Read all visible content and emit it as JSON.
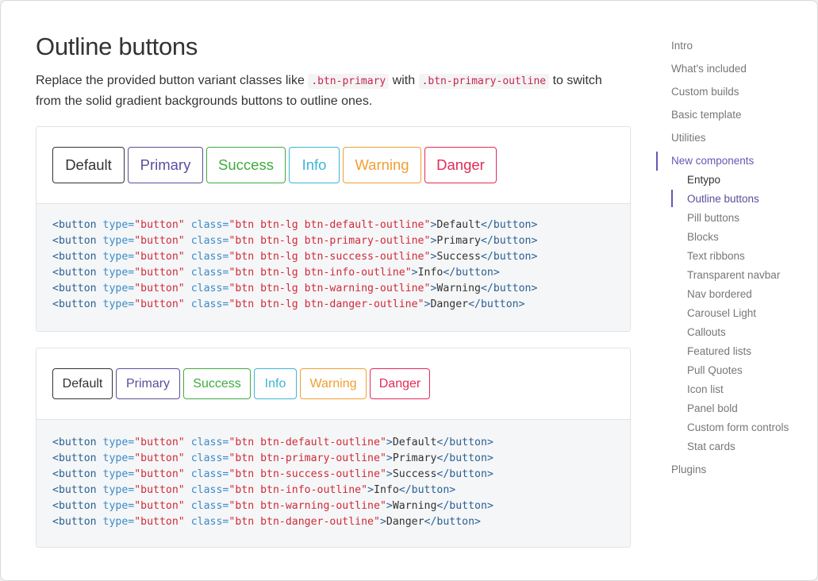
{
  "header": {
    "title": "Outline buttons",
    "lead_before": "Replace the provided button variant classes like ",
    "lead_code1": ".btn-primary",
    "lead_mid": " with ",
    "lead_code2": ".btn-primary-outline",
    "lead_after": " to switch from the solid gradient backgrounds buttons to outline ones."
  },
  "example_large": {
    "buttons": [
      "Default",
      "Primary",
      "Success",
      "Info",
      "Warning",
      "Danger"
    ],
    "code": [
      {
        "cls": "btn btn-lg btn-default-outline",
        "text": "Default"
      },
      {
        "cls": "btn btn-lg btn-primary-outline",
        "text": "Primary"
      },
      {
        "cls": "btn btn-lg btn-success-outline",
        "text": "Success"
      },
      {
        "cls": "btn btn-lg btn-info-outline",
        "text": "Info"
      },
      {
        "cls": "btn btn-lg btn-warning-outline",
        "text": "Warning"
      },
      {
        "cls": "btn btn-lg btn-danger-outline",
        "text": "Danger"
      }
    ]
  },
  "example_default": {
    "buttons": [
      "Default",
      "Primary",
      "Success",
      "Info",
      "Warning",
      "Danger"
    ],
    "code": [
      {
        "cls": "btn btn-default-outline",
        "text": "Default"
      },
      {
        "cls": "btn btn-primary-outline",
        "text": "Primary"
      },
      {
        "cls": "btn btn-success-outline",
        "text": "Success"
      },
      {
        "cls": "btn btn-info-outline",
        "text": "Info"
      },
      {
        "cls": "btn btn-warning-outline",
        "text": "Warning"
      },
      {
        "cls": "btn btn-danger-outline",
        "text": "Danger"
      }
    ]
  },
  "code_tokens": {
    "open_tag": "<button",
    "type_attr": "type=",
    "type_val": "\"button\"",
    "class_attr": "class=",
    "close_tag": "</button>"
  },
  "sidebar": {
    "items": [
      "Intro",
      "What's included",
      "Custom builds",
      "Basic template",
      "Utilities",
      "New components",
      "Plugins"
    ],
    "active": "New components",
    "subitems": [
      "Entypo",
      "Outline buttons",
      "Pill buttons",
      "Blocks",
      "Text ribbons",
      "Transparent navbar",
      "Nav bordered",
      "Carousel Light",
      "Callouts",
      "Featured lists",
      "Pull Quotes",
      "Icon list",
      "Panel bold",
      "Custom form controls",
      "Stat cards"
    ],
    "active_subitem": "Outline buttons"
  },
  "colors": {
    "default": "#333333",
    "primary": "#5b4f9c",
    "success": "#3fab3f",
    "info": "#3db5d8",
    "warning": "#f0a030",
    "danger": "#e32b57",
    "nav_active": "#6657b8"
  }
}
